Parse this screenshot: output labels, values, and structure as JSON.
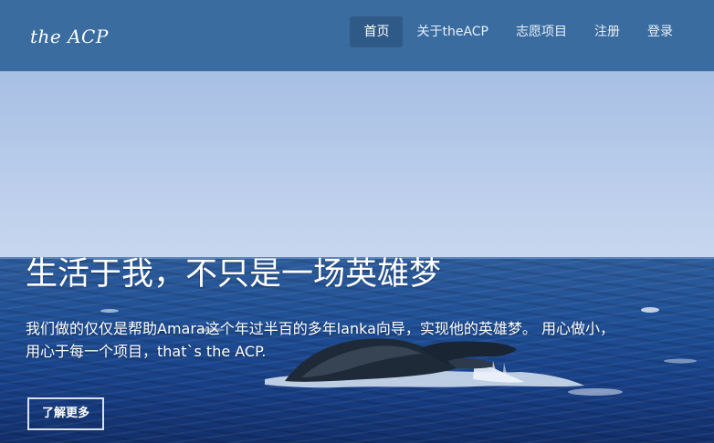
{
  "brand": {
    "logo_text": "the ACP"
  },
  "nav": {
    "items": [
      {
        "label": "首页",
        "active": true
      },
      {
        "label": "关于theACP",
        "active": false
      },
      {
        "label": "志愿项目",
        "active": false
      },
      {
        "label": "注册",
        "active": false
      },
      {
        "label": "登录",
        "active": false
      }
    ]
  },
  "hero": {
    "headline": "生活于我，不只是一场英雄梦",
    "subtext_line1": "我们做的仅仅是帮助Amara这个年过半百的多年lanka向导，实现他的英雄梦。 用心做小，",
    "subtext_line2": "用心于每一个项目，that`s the ACP.",
    "button_label": "了解更多",
    "image": "whale-tail-ocean"
  },
  "colors": {
    "navbar": "#3a6c9f",
    "nav_active": "#2f5a88",
    "sky": "#bed0ec",
    "sea": "#1f4f95"
  }
}
